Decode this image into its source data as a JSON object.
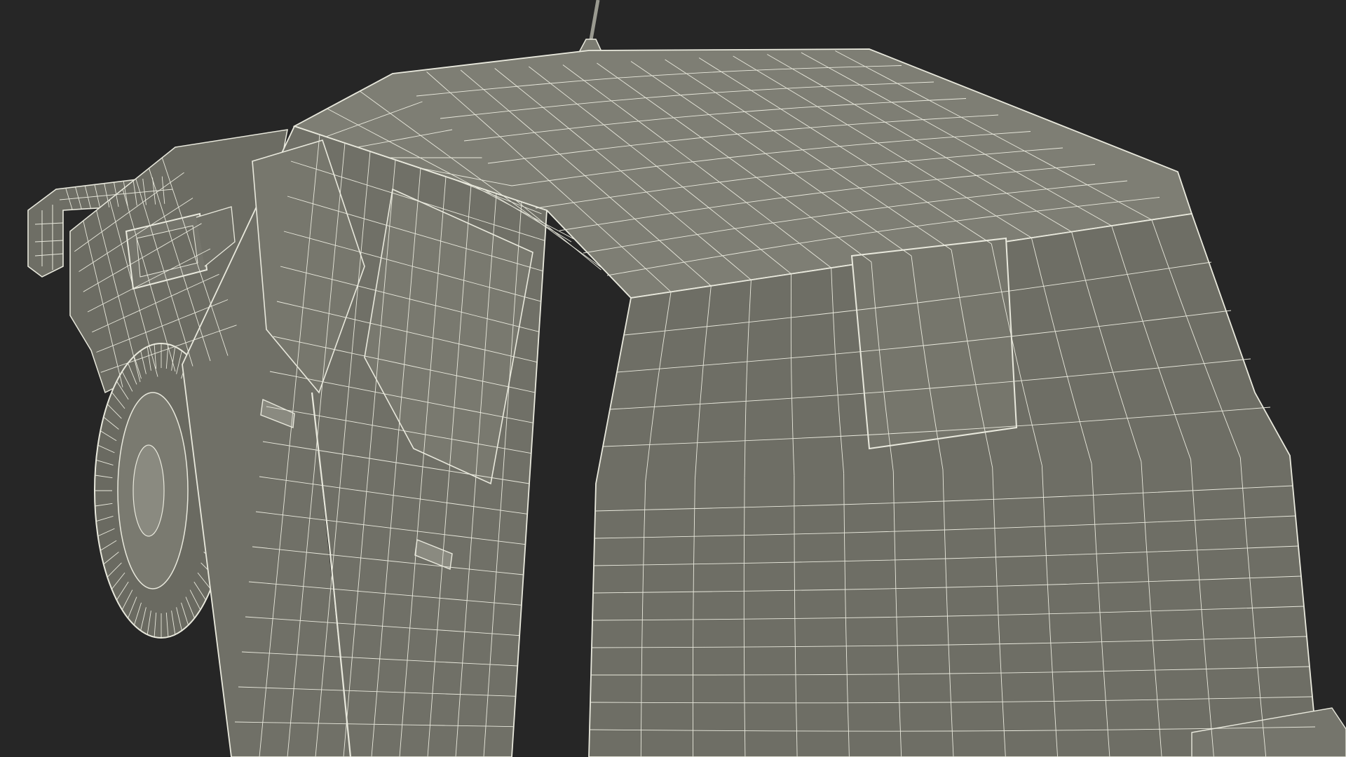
{
  "scene": {
    "subject": "truck-wireframe-render",
    "colors": {
      "background": "#262626",
      "surface": "#7c7c72",
      "surface_dark": "#6b6b62",
      "surface_light": "#8a8a80",
      "wire": "#e9e9dd"
    }
  }
}
